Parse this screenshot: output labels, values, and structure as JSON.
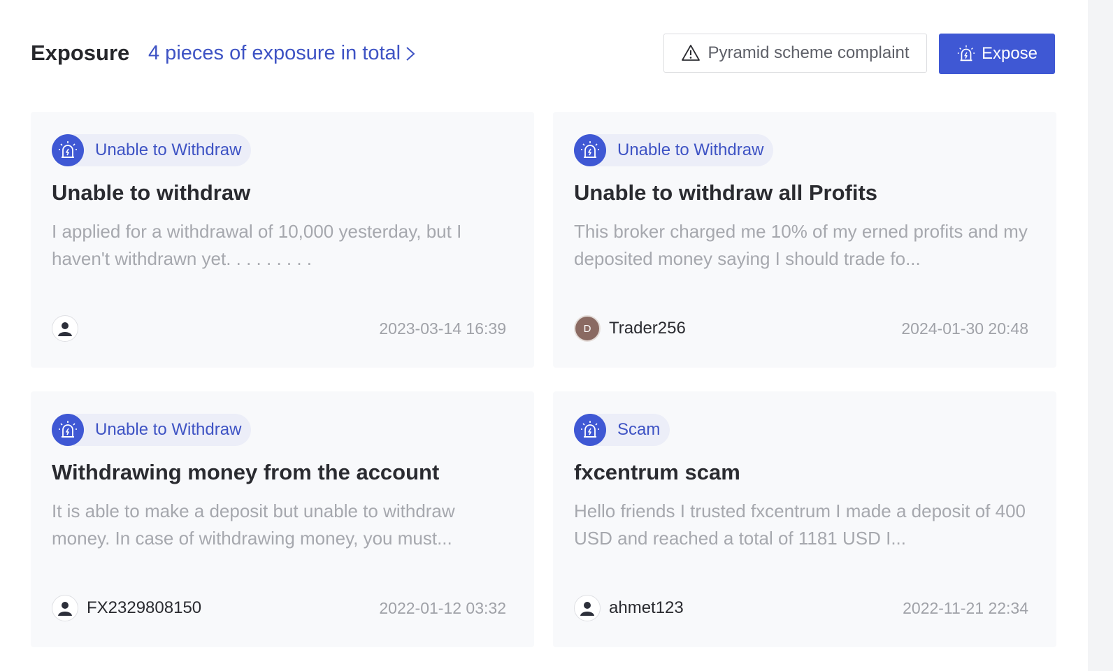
{
  "header": {
    "title": "Exposure",
    "total_link": "4 pieces of exposure in total",
    "complaint_button": "Pyramid scheme complaint",
    "expose_button": "Expose"
  },
  "colors": {
    "accent": "#3f58d4",
    "link": "#3e53c4",
    "card_bg": "#f8f9fb"
  },
  "cards": [
    {
      "tag": "Unable to Withdraw",
      "title": "Unable to withdraw",
      "excerpt": "I applied for a withdrawal of 10,000 yesterday, but I haven't withdrawn yet. . . . . . . . .",
      "user": "",
      "avatar": "default-user-icon",
      "date": "2023-03-14 16:39"
    },
    {
      "tag": "Unable to Withdraw",
      "title": "Unable to withdraw all Profits",
      "excerpt": "This broker charged me 10% of my erned profits and my deposited money saying I should trade fo...",
      "user": "Trader256",
      "avatar_letter": "D",
      "date": "2024-01-30 20:48"
    },
    {
      "tag": "Unable to Withdraw",
      "title": "Withdrawing money from the account",
      "excerpt": "It is able to make a deposit but unable to withdraw money. In case of withdrawing money, you must...",
      "user": "FX2329808150",
      "avatar": "default-user-icon",
      "date": "2022-01-12 03:32"
    },
    {
      "tag": "Scam",
      "title": "fxcentrum scam",
      "excerpt": "Hello friends I trusted fxcentrum I made a deposit of 400 USD and reached a total of 1181 USD I...",
      "user": "ahmet123",
      "avatar": "default-user-icon",
      "date": "2022-11-21 22:34"
    }
  ]
}
